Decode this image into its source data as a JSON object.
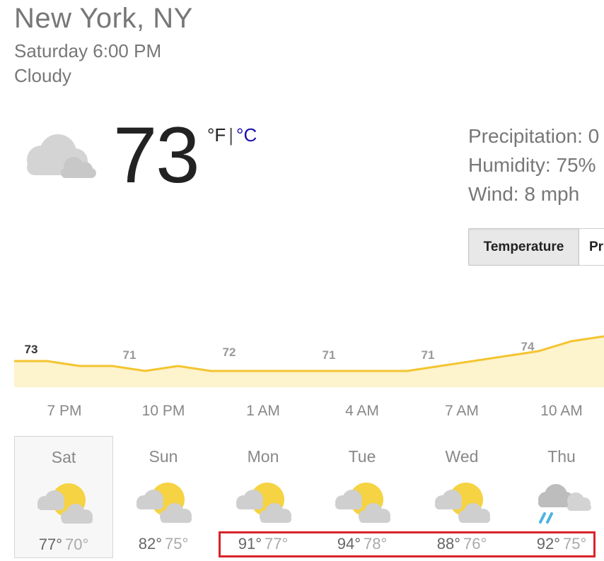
{
  "location": "New York, NY",
  "datetime": "Saturday 6:00 PM",
  "condition": "Cloudy",
  "current": {
    "icon": "cloudy-icon",
    "temperature": "73",
    "unit_f": "°F",
    "unit_sep": "|",
    "unit_c": "°C"
  },
  "details": {
    "precipitation": "Precipitation: 0",
    "humidity": "Humidity: 75%",
    "wind": "Wind: 8 mph"
  },
  "tabs": [
    {
      "label": "Temperature",
      "active": true
    },
    {
      "label": "Pr",
      "active": false
    }
  ],
  "hourly": {
    "labels": [
      "7 PM",
      "10 PM",
      "1 AM",
      "4 AM",
      "7 AM",
      "10 AM"
    ],
    "temp_labels": [
      "73",
      "71",
      "72",
      "71",
      "71",
      "74"
    ]
  },
  "chart_data": {
    "type": "area",
    "series": [
      {
        "values": [
          73,
          73,
          72,
          72,
          71,
          72,
          71,
          71,
          71,
          71,
          71,
          71,
          71,
          72,
          73,
          74,
          75,
          77,
          78
        ]
      }
    ],
    "line_color": "#f4c430",
    "fill_color": "#fdf3cc"
  },
  "daily": [
    {
      "day": "Sat",
      "icon": "partly-sunny-icon",
      "high": "77°",
      "low": "70°",
      "selected": true
    },
    {
      "day": "Sun",
      "icon": "partly-sunny-icon",
      "high": "82°",
      "low": "75°"
    },
    {
      "day": "Mon",
      "icon": "partly-sunny-icon",
      "high": "91°",
      "low": "77°"
    },
    {
      "day": "Tue",
      "icon": "partly-sunny-icon",
      "high": "94°",
      "low": "78°"
    },
    {
      "day": "Wed",
      "icon": "partly-sunny-icon",
      "high": "88°",
      "low": "76°"
    },
    {
      "day": "Thu",
      "icon": "rain-icon",
      "high": "92°",
      "low": "75°"
    }
  ],
  "colors": {
    "highlight": "#d9232a",
    "sun": "#f5d342",
    "cloud": "#cfcfcf",
    "rain": "#4ab3e6"
  }
}
